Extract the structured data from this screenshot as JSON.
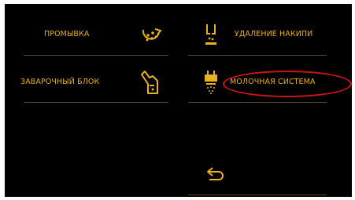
{
  "colors": {
    "background": "#000000",
    "accent": "#e9b01f",
    "divider": "#5a4a22",
    "annotation": "#d4121a"
  },
  "menu": {
    "rinse": {
      "label": "ПРОМЫВКА",
      "icon": "rinse-icon"
    },
    "descale": {
      "label": "УДАЛЕНИЕ НАКИПИ",
      "icon": "descale-icon"
    },
    "brew_unit": {
      "label": "ЗАВАРОЧНЫЙ БЛОК",
      "icon": "brew-unit-icon"
    },
    "milk_system": {
      "label": "МОЛОЧНАЯ СИСТЕМА",
      "icon": "milk-system-icon"
    }
  },
  "back": {
    "icon": "back-arrow-icon"
  }
}
